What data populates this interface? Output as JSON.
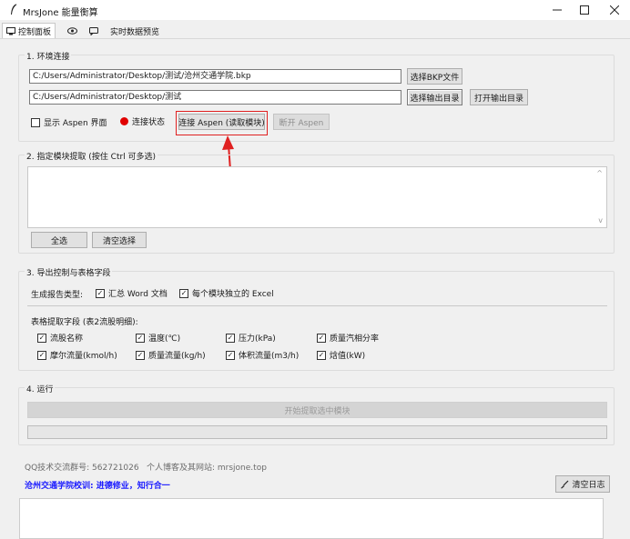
{
  "window": {
    "title": "MrsJone 能量衡算",
    "icons": {
      "app": "feather-icon",
      "minimize": "minimize-icon",
      "maximize": "maximize-icon",
      "close": "close-icon"
    }
  },
  "tabs": [
    {
      "label": "控制面板",
      "icon": "monitor-icon"
    },
    {
      "label": "",
      "icon": "eye-icon"
    },
    {
      "label": "",
      "icon": "chat-icon"
    },
    {
      "label": "实时数据预览",
      "icon": ""
    }
  ],
  "env": {
    "title": "1. 环境连接",
    "bkp_path": "C:/Users/Administrator/Desktop/测试/沧州交通学院.bkp",
    "out_path": "C:/Users/Administrator/Desktop/测试",
    "select_bkp": "选择BKP文件",
    "select_out": "选择输出目录",
    "open_out": "打开输出目录",
    "show_aspen": "显示 Aspen 界面",
    "status_label": "连接状态",
    "status_color": "#e00000",
    "connect": "连接 Aspen (读取模块)",
    "disconnect": "断开 Aspen"
  },
  "modules": {
    "title": "2. 指定模块提取 (按住 Ctrl 可多选)",
    "select_all": "全选",
    "clear_selection": "清空选择"
  },
  "export": {
    "title": "3. 导出控制与表格字段",
    "report_type_label": "生成报告类型:",
    "report_types": [
      {
        "label": "汇总 Word 文档",
        "checked": true
      },
      {
        "label": "每个模块独立的 Excel",
        "checked": true
      }
    ],
    "fields_label": "表格提取字段 (表2流股明细):",
    "fields": [
      {
        "label": "流股名称",
        "checked": true
      },
      {
        "label": "温度(℃)",
        "checked": true
      },
      {
        "label": "压力(kPa)",
        "checked": true
      },
      {
        "label": "质量汽相分率",
        "checked": true
      },
      {
        "label": "摩尔流量(kmol/h)",
        "checked": true
      },
      {
        "label": "质量流量(kg/h)",
        "checked": true
      },
      {
        "label": "体积流量(m3/h)",
        "checked": true
      },
      {
        "label": "焓值(kW)",
        "checked": true
      }
    ]
  },
  "run": {
    "title": "4. 运行",
    "start": "开始提取选中模块",
    "progress": 0
  },
  "footer": {
    "qq": "QQ技术交流群号: 562721026",
    "site": "个人博客及其网站: mrsjone.top",
    "motto": "沧州交通学院校训: 进德修业，知行合一",
    "motto_color": "#1a1aff",
    "clear_log": "清空日志",
    "clear_log_icon": "broom-icon"
  },
  "annotation": {
    "color": "#e02020"
  }
}
